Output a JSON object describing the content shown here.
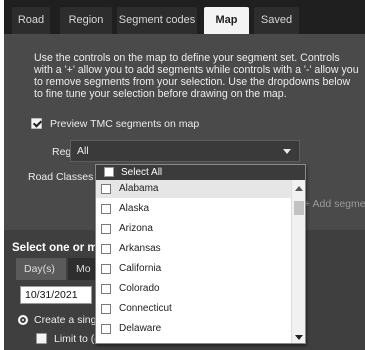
{
  "tabs": [
    {
      "label": "Road"
    },
    {
      "label": "Region"
    },
    {
      "label": "Segment codes"
    },
    {
      "label": "Map"
    },
    {
      "label": "Saved"
    }
  ],
  "active_tab": "Map",
  "instructions": "Use the controls on the map to define your segment set. Controls with a '+' allow you to add segments while controls with a '-' allow you to remove segments from your selection. Use the dropdowns below to fine tune your selection before drawing on the map.",
  "preview": {
    "label": "Preview TMC segments on map",
    "checked": true
  },
  "regions": {
    "label": "Regions",
    "value": "All"
  },
  "road_classes": {
    "label": "Road Classes"
  },
  "add_button": {
    "label": "+ Add segments"
  },
  "section": {
    "title": "Select one or m"
  },
  "subtabs": [
    {
      "label": "Day(s)"
    },
    {
      "label": "Mo"
    }
  ],
  "date_value": "10/31/2021",
  "radio_label": "Create a sing",
  "limit_label": "Limit to (d",
  "dropdown": {
    "select_all": "Select All",
    "options": [
      "Alabama",
      "Alaska",
      "Arizona",
      "Arkansas",
      "California",
      "Colorado",
      "Connecticut",
      "Delaware"
    ]
  },
  "colors": {
    "background": "#4a4a4a",
    "tabbar": "#1f1f1f",
    "active_tab": "#f4f4f4"
  }
}
